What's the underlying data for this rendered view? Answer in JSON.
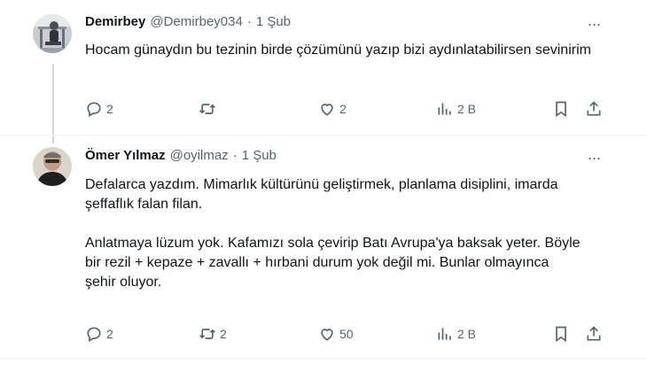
{
  "tweets": [
    {
      "name": "Demirbey",
      "handle": "@Demirbey034",
      "separator": "·",
      "time": "1 Şub",
      "text": [
        "Hocam günaydın bu tezinin birde çözümünü yazıp bizi aydınlatabilirsen sevinirim"
      ],
      "actions": {
        "reply": "2",
        "retweet": "",
        "like": "2",
        "views": "2 B"
      }
    },
    {
      "name": "Ömer Yılmaz",
      "handle": "@oyilmaz",
      "separator": "·",
      "time": "1 Şub",
      "text": [
        "Defalarca yazdım. Mimarlık kültürünü geliştirmek, planlama disiplini, imarda şeffaflık falan filan.",
        "Anlatmaya lüzum yok. Kafamızı sola çevirip Batı Avrupa'ya baksak yeter. Böyle bir rezil + kepaze + zavallı + hırbani durum yok değil mi. Bunlar olmayınca şehir oluyor."
      ],
      "actions": {
        "reply": "2",
        "retweet": "2",
        "like": "50",
        "views": "2 B"
      }
    }
  ],
  "more_glyph": "···",
  "colors": {
    "text": "#0f1419",
    "secondary": "#536471",
    "divider": "#eff3f4",
    "thread": "#cfd9de"
  },
  "icons": [
    "more-icon",
    "reply-icon",
    "retweet-icon",
    "like-icon",
    "views-icon",
    "bookmark-icon",
    "share-icon"
  ]
}
